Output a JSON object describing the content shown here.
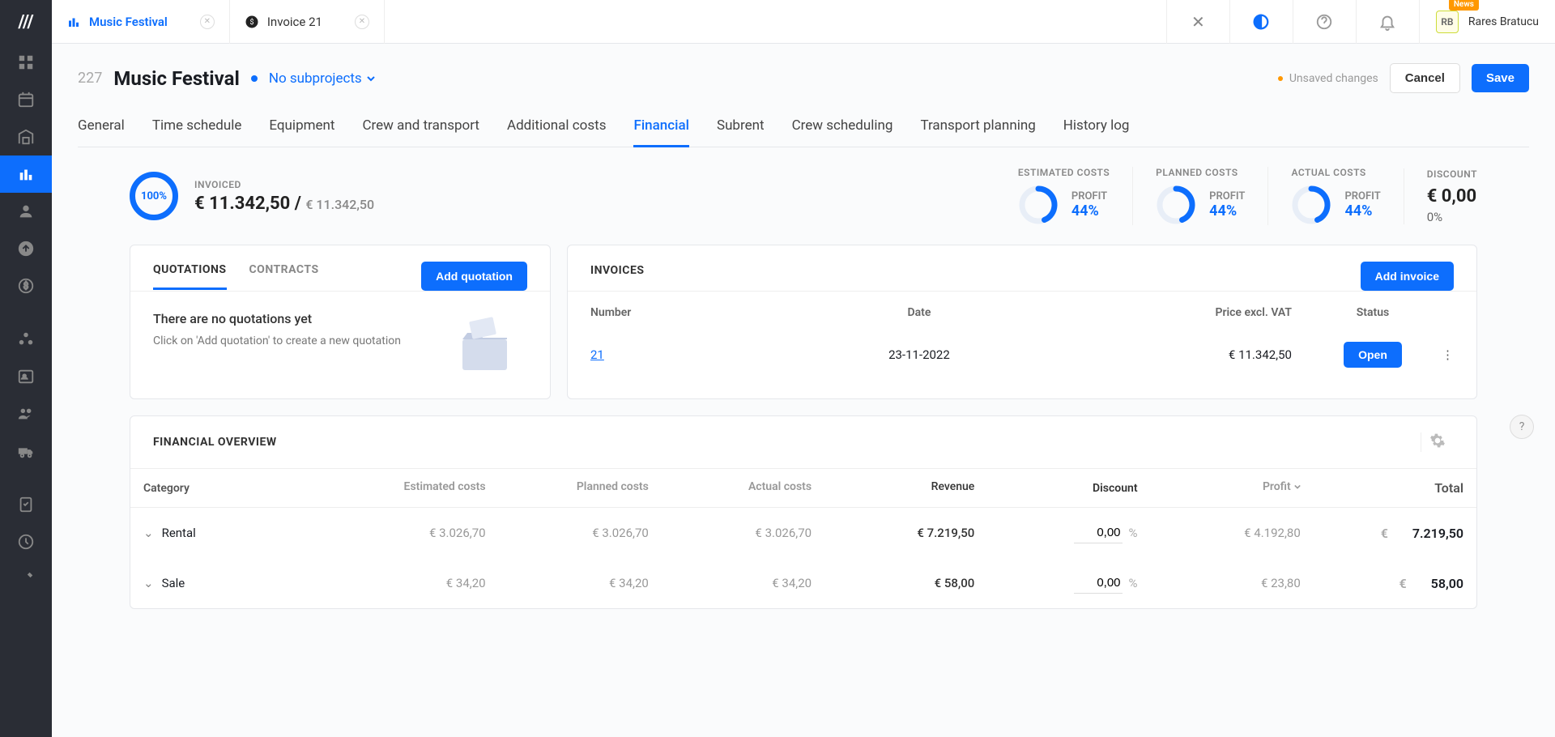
{
  "logo": "///",
  "tabs": [
    {
      "title": "Music Festival",
      "link": true
    },
    {
      "title": "Invoice 21",
      "link": false
    }
  ],
  "user": {
    "initials": "RB",
    "name": "Rares Bratucu",
    "news": "News"
  },
  "page": {
    "num": "227",
    "title": "Music Festival",
    "subprojects": "No subprojects",
    "unsaved": "Unsaved changes",
    "cancel": "Cancel",
    "save": "Save"
  },
  "nav": [
    "General",
    "Time schedule",
    "Equipment",
    "Crew and transport",
    "Additional costs",
    "Financial",
    "Subrent",
    "Crew scheduling",
    "Transport planning",
    "History log"
  ],
  "nav_active": 5,
  "stats": {
    "invoiced_pct": "100%",
    "invoiced_label": "INVOICED",
    "invoiced_val": "€ 11.342,50",
    "invoiced_total": "€ 11.342,50",
    "blocks": [
      {
        "label": "ESTIMATED COSTS",
        "profit": "PROFIT",
        "pct": "44%"
      },
      {
        "label": "PLANNED COSTS",
        "profit": "PROFIT",
        "pct": "44%"
      },
      {
        "label": "ACTUAL COSTS",
        "profit": "PROFIT",
        "pct": "44%"
      }
    ],
    "discount": {
      "label": "DISCOUNT",
      "val": "€ 0,00",
      "pct": "0%"
    }
  },
  "quotations": {
    "tabs": [
      "QUOTATIONS",
      "CONTRACTS"
    ],
    "add": "Add quotation",
    "empty_title": "There are no quotations yet",
    "empty_text": "Click on 'Add quotation' to create a new quotation"
  },
  "invoices": {
    "title": "INVOICES",
    "add": "Add invoice",
    "headers": {
      "num": "Number",
      "date": "Date",
      "price": "Price excl. VAT",
      "status": "Status"
    },
    "rows": [
      {
        "num": "21",
        "date": "23-11-2022",
        "price": "€ 11.342,50",
        "action": "Open"
      }
    ]
  },
  "financial": {
    "title": "FINANCIAL OVERVIEW",
    "headers": {
      "cat": "Category",
      "est": "Estimated costs",
      "plan": "Planned costs",
      "act": "Actual costs",
      "rev": "Revenue",
      "disc": "Discount",
      "prof": "Profit",
      "tot": "Total"
    },
    "rows": [
      {
        "cat": "Rental",
        "est": "€ 3.026,70",
        "plan": "€ 3.026,70",
        "act": "€ 3.026,70",
        "rev": "€ 7.219,50",
        "disc": "0,00",
        "prof": "€ 4.192,80",
        "cur": "€",
        "tot": "7.219,50"
      },
      {
        "cat": "Sale",
        "est": "€ 34,20",
        "plan": "€ 34,20",
        "act": "€ 34,20",
        "rev": "€ 58,00",
        "disc": "0,00",
        "prof": "€ 23,80",
        "cur": "€",
        "tot": "58,00"
      }
    ],
    "pct_sym": "%"
  }
}
